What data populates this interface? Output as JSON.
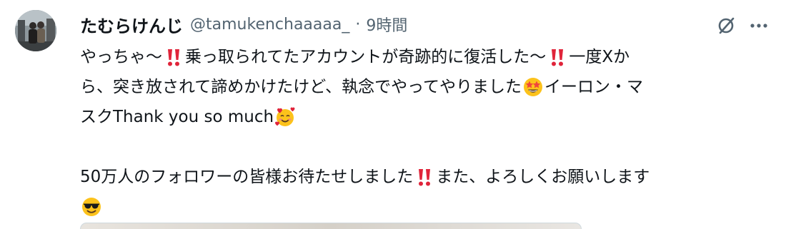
{
  "user": {
    "display_name": "たむらけんじ",
    "handle": "@tamukenchaaaaa_",
    "separator": "·",
    "time": "9時間"
  },
  "icons": {
    "avatar": "user-avatar",
    "grok": "grok-icon",
    "more": "more-icon",
    "double_exclamation": "double-exclamation-emoji",
    "star_struck": "star-struck-emoji",
    "smiling_hearts": "smiling-face-with-hearts-emoji",
    "sunglasses": "smiling-face-with-sunglasses-emoji"
  },
  "tweet": {
    "line1_a": "やっちゃ～",
    "line1_b": "乗っ取られてたアカウントが奇跡的に復活した～",
    "line1_c": "一度Xか",
    "line2_a": "ら、突き放されて諦めかけたけど、執念でやってやりました",
    "line2_b": "イーロン・マ",
    "line3_a": "スクThank you so much",
    "line5_a": "50万人のフォロワーの皆様お待たせしました",
    "line5_b": "また、よろしくお願いします"
  }
}
